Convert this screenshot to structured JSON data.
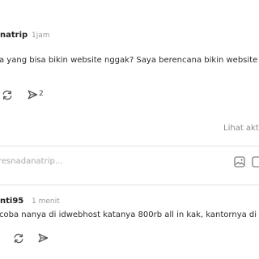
{
  "comment1": {
    "author": "natrip",
    "time": "1jam",
    "text": "a yang bisa bikin website nggak? Saya berencana bikin website",
    "reply_count": "2"
  },
  "view_more": "Lihat akt",
  "reply_input": {
    "placeholder": "resnadanatrip..."
  },
  "comment2": {
    "author": "nti95",
    "time": "1 menit",
    "text": "coba nanya di idwebhost katanya 800rb all in kak, kantornya di j"
  },
  "icons": {
    "repost": "repost-icon",
    "reply": "reply-arrow-icon",
    "image": "image-icon",
    "gif": "gif-icon"
  }
}
